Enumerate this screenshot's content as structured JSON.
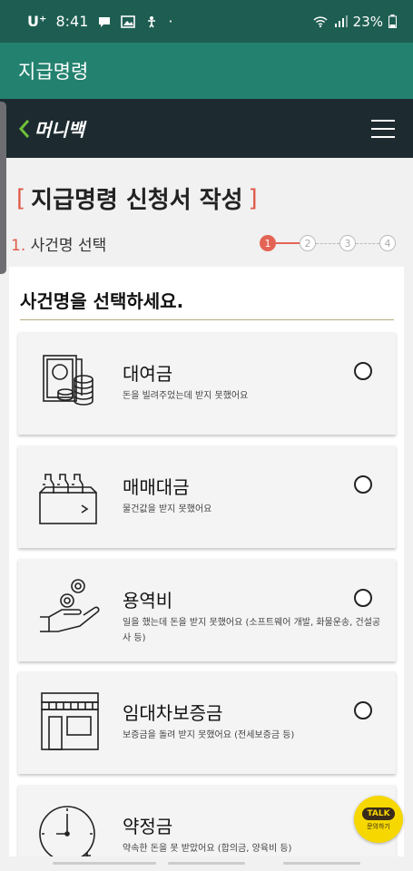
{
  "status": {
    "carrier": "U⁺",
    "time": "8:41",
    "battery": "23%"
  },
  "app": {
    "title": "지급명령"
  },
  "site": {
    "logo": "머니백"
  },
  "page": {
    "title": "지급명령 신청서 작성",
    "bracket_open": "[",
    "bracket_close": "]",
    "step_num": "1.",
    "step_name": "사건명 선택",
    "steps": [
      "1",
      "2",
      "3",
      "4"
    ]
  },
  "panel": {
    "heading": "사건명을 선택하세요.",
    "items": [
      {
        "name": "대여금",
        "desc": "돈을 빌려주었는데 받지 못했어요",
        "icon": "money-coins-icon"
      },
      {
        "name": "매매대금",
        "desc": "물건값을 받지 못했어요",
        "icon": "bottles-box-icon"
      },
      {
        "name": "용역비",
        "desc": "일을 했는데 돈을 받지 못했어요 (소프트웨어 개발, 화물운송, 건설공사 등)",
        "icon": "hand-coin-icon"
      },
      {
        "name": "임대차보증금",
        "desc": "보증금을 돌려 받지 못했어요 (전세보증금 등)",
        "icon": "storefront-icon"
      },
      {
        "name": "약정금",
        "desc": "약속한 돈을 못 받았어요 (합의금, 양육비 등)",
        "icon": "clock-dollar-icon"
      }
    ]
  },
  "talk": {
    "label": "TALK",
    "sub": "문의하기"
  },
  "colors": {
    "statusbar": "#1e5e52",
    "appbar": "#23826f",
    "header": "#1d2b30",
    "accent": "#e36455"
  }
}
